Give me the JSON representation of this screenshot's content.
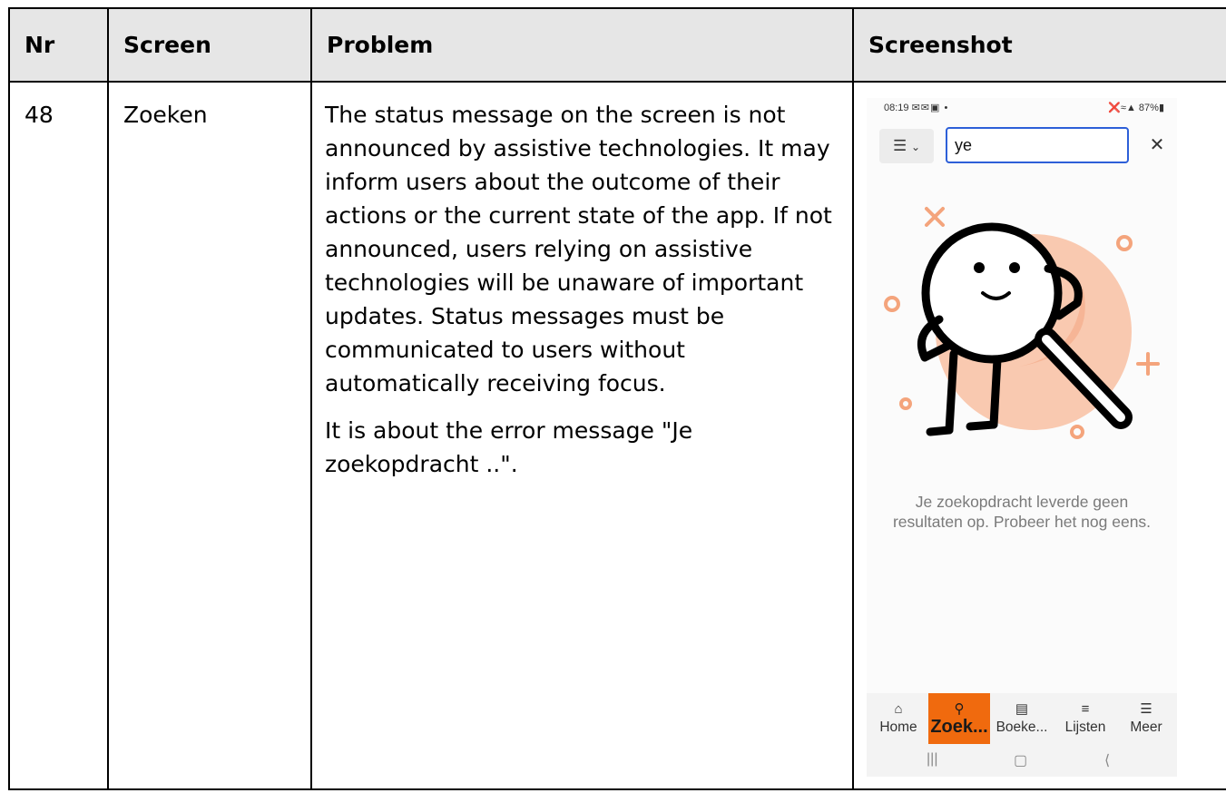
{
  "headers": {
    "nr": "Nr",
    "screen": "Screen",
    "problem": "Problem",
    "screenshot": "Screenshot"
  },
  "row": {
    "nr": "48",
    "screen": "Zoeken",
    "problem_p1": "The status message on the screen is not announced by assistive technologies. It may inform users about the outcome of their actions or the current state of the app. If not announced, users relying on assistive technologies will be unaware of important updates. Status messages must be communicated to users without automatically receiving focus.",
    "problem_p2": "It is about the error message \"Je zoekopdracht ..\"."
  },
  "phone": {
    "status_time": "08:19",
    "status_battery": "87%",
    "search_value": "ye",
    "menu_icon": "list-menu-icon",
    "clear_icon": "close-icon",
    "no_results_text": "Je zoekopdracht leverde geen resultaten op. Probeer het nog eens.",
    "nav": [
      {
        "label": "Home",
        "icon": "home-icon"
      },
      {
        "label": "Zoek...",
        "icon": "search-icon"
      },
      {
        "label": "Boeke...",
        "icon": "book-icon"
      },
      {
        "label": "Lijsten",
        "icon": "list-heart-icon"
      },
      {
        "label": "Meer",
        "icon": "hamburger-icon"
      }
    ],
    "colors": {
      "accent": "#f06a0e",
      "illustration_peach": "#f9c9b0",
      "search_border": "#2d5fd8"
    }
  }
}
